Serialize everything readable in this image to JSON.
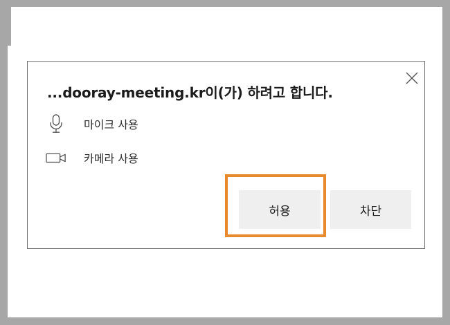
{
  "dialog": {
    "title": "...dooray-meeting.kr이(가) 하려고 합니다.",
    "permissions": [
      {
        "icon": "microphone-icon",
        "label": "마이크 사용"
      },
      {
        "icon": "camera-icon",
        "label": "카메라 사용"
      }
    ],
    "buttons": {
      "allow_label": "허용",
      "block_label": "차단"
    },
    "close_icon": "close-icon"
  },
  "colors": {
    "frame": "#a7a7a7",
    "dialog_border": "#6f6f6f",
    "button_bg": "#efefef",
    "highlight": "#e8892d",
    "text": "#1b1b1b"
  }
}
